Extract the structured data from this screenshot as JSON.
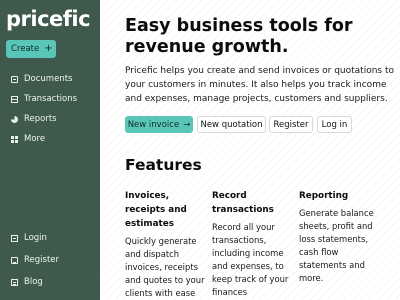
{
  "brand": {
    "logo": "pricefic",
    "accent": "#5ac6b7",
    "sidebar_bg": "#3f5a4d"
  },
  "sidebar": {
    "create_label": "Create",
    "create_icon": "plus-icon",
    "items": [
      {
        "label": "Documents",
        "icon": "document-icon"
      },
      {
        "label": "Transactions",
        "icon": "list-icon"
      },
      {
        "label": "Reports",
        "icon": "pie-chart-icon"
      },
      {
        "label": "More",
        "icon": "grid-icon"
      }
    ],
    "bottom_items": [
      {
        "label": "Login",
        "icon": "login-icon"
      },
      {
        "label": "Register",
        "icon": "register-icon"
      },
      {
        "label": "Blog",
        "icon": "blog-icon"
      }
    ]
  },
  "hero": {
    "title": "Easy business tools for revenue growth.",
    "description": "Pricefic helps you create and send invoices or quotations to your customers in minutes. It also helps you track income and expenses, manage projects, customers and suppliers.",
    "buttons": {
      "new_invoice": "New invoice",
      "new_quotation": "New quotation",
      "register": "Register",
      "login": "Log in"
    }
  },
  "features": {
    "title": "Features",
    "items": [
      {
        "title": "Invoices, receipts and estimates",
        "body": "Quickly generate and dispatch invoices, receipts and quotes to your clients with ease and efficiency."
      },
      {
        "title": "Record transactions",
        "body": "Record all your transactions, including income and expenses, to keep track of your finances effortlessly."
      },
      {
        "title": "Reporting",
        "body": "Generate balance sheets, profit and loss statements, cash flow statements and more."
      }
    ]
  }
}
